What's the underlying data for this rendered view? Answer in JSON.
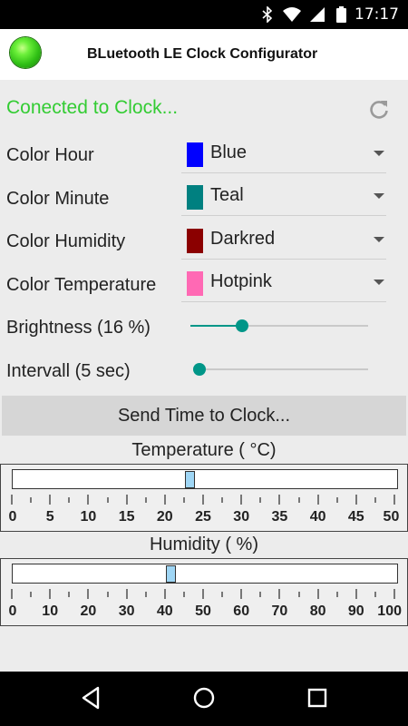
{
  "status_bar": {
    "time": "17:17",
    "icons": [
      "bluetooth-icon",
      "wifi-icon",
      "signal-icon",
      "battery-icon"
    ]
  },
  "app": {
    "title": "BLuetooth LE Clock Configurator",
    "led_color": "#33cc33"
  },
  "connection": {
    "status": "Conected to Clock...",
    "status_color": "#33cc33"
  },
  "settings": {
    "hour_label": "Color Hour",
    "hour_value": "Blue",
    "hour_color": "#0000ff",
    "minute_label": "Color Minute",
    "minute_value": "Teal",
    "minute_color": "#008080",
    "humidity_label": "Color Humidity",
    "humidity_value": "Darkred",
    "humidity_color": "#8b0000",
    "temperature_label": "Color Temperature",
    "temperature_value": "Hotpink",
    "temperature_color": "#ff69b4",
    "brightness_label": "Brightness (16 %)",
    "brightness_fraction": 0.29,
    "interval_label": "Intervall (5 sec)",
    "interval_fraction": 0.0,
    "accent_color": "#009688"
  },
  "send_button": {
    "label": "Send Time to Clock..."
  },
  "temperature_gauge": {
    "title": "Temperature ( °C)",
    "min": 0,
    "max": 50,
    "value": 23,
    "labels": [
      "0",
      "5",
      "10",
      "15",
      "20",
      "25",
      "30",
      "35",
      "40",
      "45",
      "50"
    ]
  },
  "humidity_gauge": {
    "title": "Humidity ( %)",
    "min": 0,
    "max": 100,
    "value": 41,
    "labels": [
      "0",
      "10",
      "20",
      "30",
      "40",
      "50",
      "60",
      "70",
      "80",
      "90",
      "100"
    ]
  },
  "nav_bar": {
    "items": [
      "back-icon",
      "home-icon",
      "recents-icon"
    ]
  }
}
